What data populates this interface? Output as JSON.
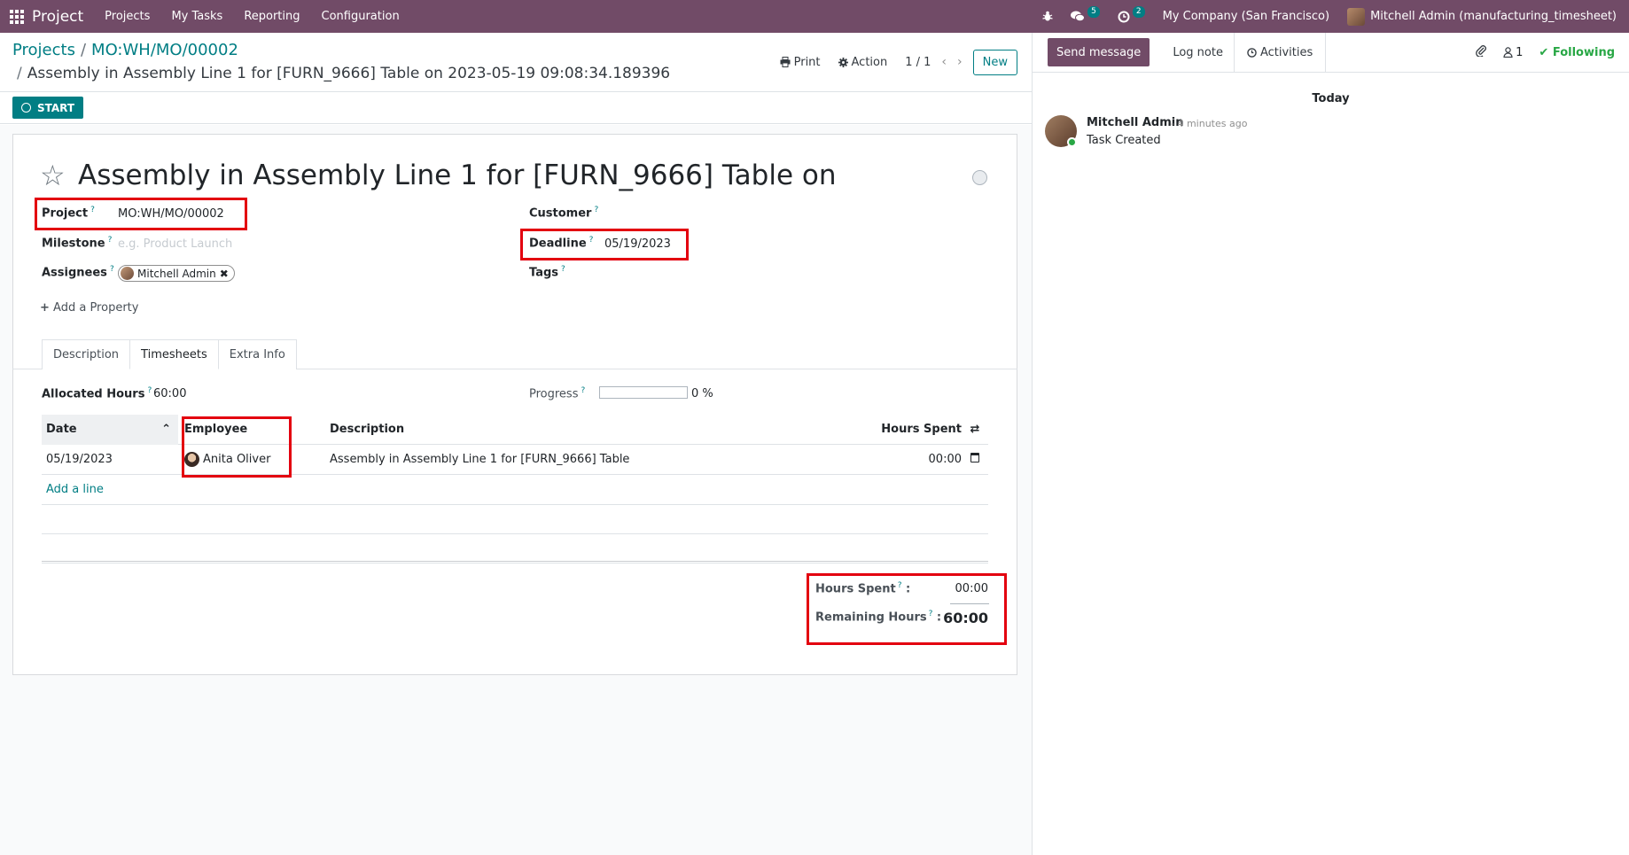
{
  "navbar": {
    "app_name": "Project",
    "menu": [
      "Projects",
      "My Tasks",
      "Reporting",
      "Configuration"
    ],
    "messages_count": "5",
    "activities_count": "2",
    "company": "My Company (San Francisco)",
    "user": "Mitchell Admin (manufacturing_timesheet)"
  },
  "control": {
    "breadcrumb": [
      "Projects",
      "MO:WH/MO/00002"
    ],
    "record_title": "Assembly in Assembly Line 1 for [FURN_9666] Table on 2023-05-19 09:08:34.189396",
    "print_label": "Print",
    "action_label": "Action",
    "pager": "1 / 1",
    "new_label": "New"
  },
  "statusbar": {
    "start_label": "START"
  },
  "form": {
    "task_name": "Assembly in Assembly Line 1 for [FURN_9666] Table on",
    "project_label": "Project",
    "project_value": "MO:WH/MO/00002",
    "milestone_label": "Milestone",
    "milestone_placeholder": "e.g. Product Launch",
    "assignees_label": "Assignees",
    "assignee": "Mitchell Admin",
    "customer_label": "Customer",
    "deadline_label": "Deadline",
    "deadline_value": "05/19/2023",
    "tags_label": "Tags",
    "add_property": "Add a Property",
    "help_mark": "?"
  },
  "tabs": [
    "Description",
    "Timesheets",
    "Extra Info"
  ],
  "timesheets": {
    "allocated_label": "Allocated Hours",
    "allocated_value": "60:00",
    "progress_label": "Progress",
    "progress_value": "0 %",
    "progress_fraction": 0,
    "columns": {
      "date": "Date",
      "employee": "Employee",
      "description": "Description",
      "hours": "Hours Spent"
    },
    "rows": [
      {
        "date": "05/19/2023",
        "employee": "Anita Oliver",
        "description": "Assembly in Assembly Line 1 for [FURN_9666] Table",
        "hours": "00:00"
      }
    ],
    "add_line": "Add a line",
    "hours_spent_label": "Hours Spent",
    "hours_spent_value": "00:00",
    "remaining_label": "Remaining Hours",
    "remaining_value": "60:00"
  },
  "chatter": {
    "send_message": "Send message",
    "log_note": "Log note",
    "activities": "Activities",
    "followers_count": "1",
    "following": "Following",
    "today": "Today",
    "author": "Mitchell Admin",
    "time": "- 4 minutes ago",
    "body": "Task Created"
  },
  "colors": {
    "brand": "#714b67",
    "accent": "#017e84",
    "highlight": "#e3000f"
  }
}
